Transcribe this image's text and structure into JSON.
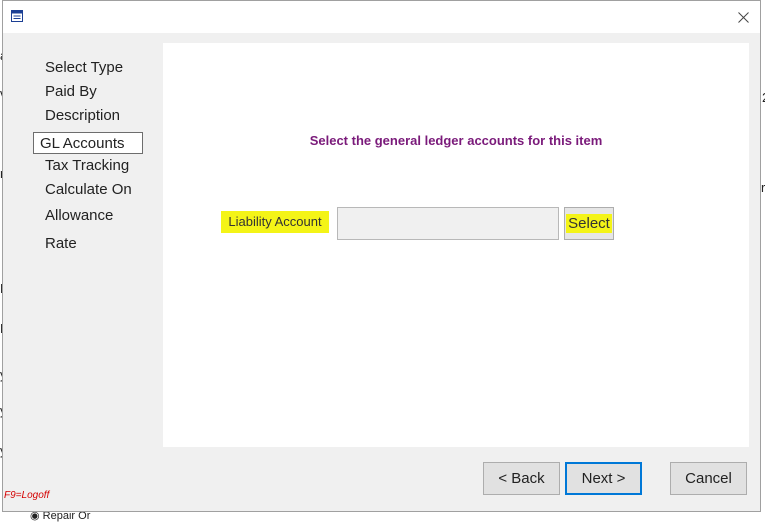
{
  "dialog": {
    "icon": "window-app-icon",
    "close_icon": "close-icon"
  },
  "steps": [
    {
      "label": "Select Type"
    },
    {
      "label": "Paid By"
    },
    {
      "label": "Description"
    },
    {
      "label": "GL Accounts"
    },
    {
      "label": "Tax Tracking"
    },
    {
      "label": "Calculate On"
    },
    {
      "label": "Allowance"
    },
    {
      "label": "Rate"
    }
  ],
  "active_step": "GL Accounts",
  "content": {
    "instruction": "Select the general ledger accounts for this item",
    "liability_label": "Liability Account",
    "liability_value": "",
    "select_label": "Select"
  },
  "buttons": {
    "back": "< Back",
    "next": "Next >",
    "cancel": "Cancel"
  },
  "footer": {
    "logoff_hint": "F9=Logoff"
  },
  "background": {
    "fragments": [
      "a",
      "v",
      "r",
      "E",
      "E",
      "y",
      "y",
      "y",
      "2",
      "ro",
      "Repair Or"
    ]
  },
  "colors": {
    "instruction": "#7a1a7a",
    "highlight": "#f4f417",
    "primary_border": "#0078d7",
    "logoff_red": "#d40000"
  }
}
